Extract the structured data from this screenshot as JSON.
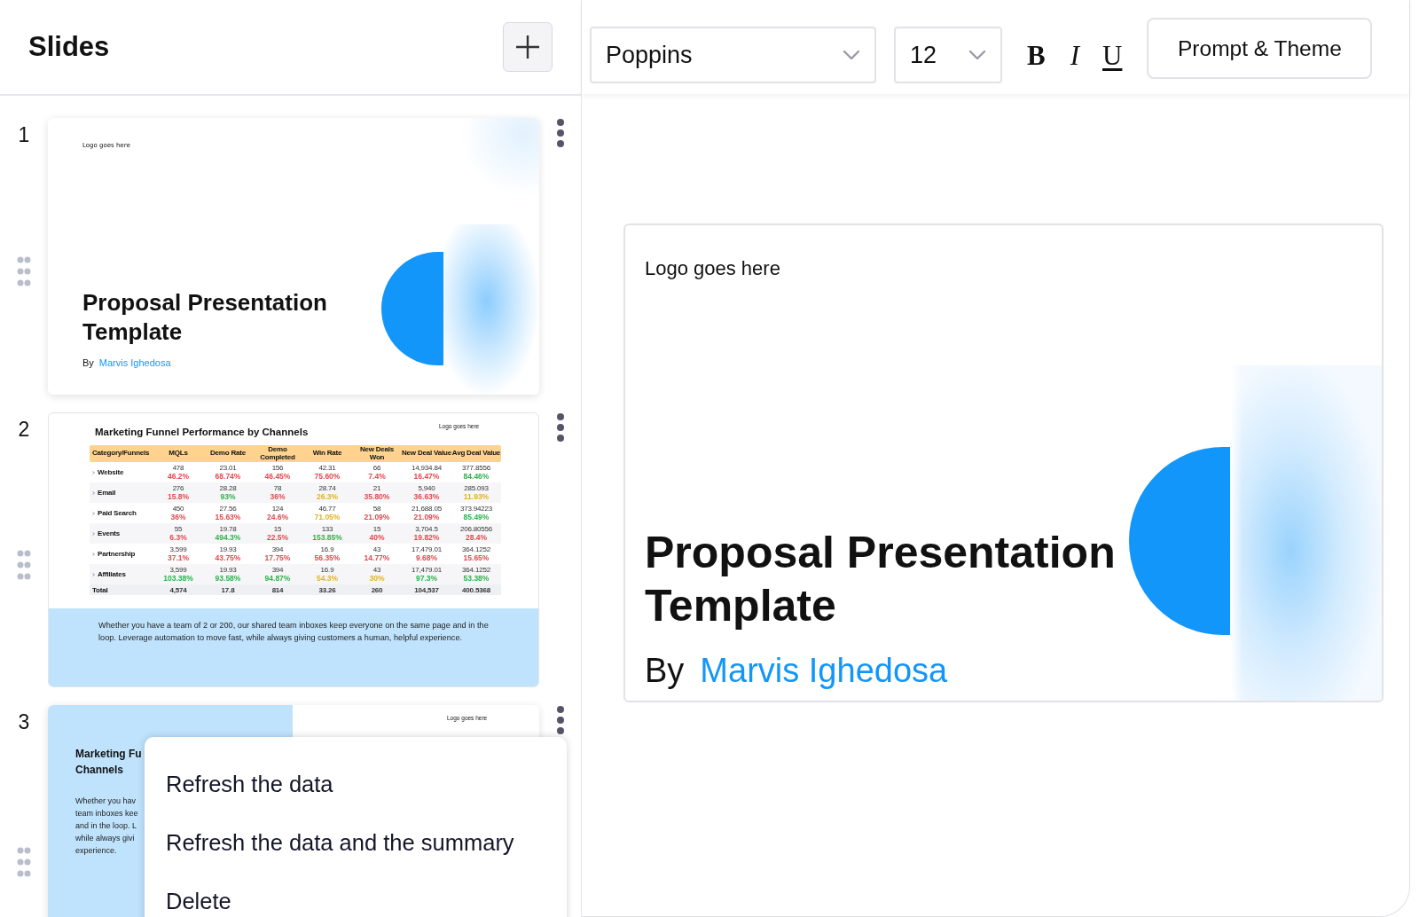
{
  "sidebar": {
    "title": "Slides",
    "slides": [
      {
        "number": "1",
        "kind": "title",
        "logo": "Logo goes here",
        "title": "Proposal Presentation Template",
        "by": "By",
        "author": "Marvis Ighedosa"
      },
      {
        "number": "2",
        "kind": "table",
        "title": "Marketing Funnel Performance by Channels",
        "logo": "Logo goes here",
        "columns": [
          "Category/Funnels",
          "MQLs",
          "Demo Rate",
          "Demo Completed",
          "Win Rate",
          "New Deals Won",
          "New Deal Value",
          "Avg Deal Value"
        ],
        "rows": [
          {
            "name": "Website",
            "values": [
              "478",
              "23.01",
              "156",
              "42.31",
              "66",
              "14,934.84",
              "377.8556"
            ],
            "changes": [
              {
                "text": "46.2%",
                "color": "#e5484d"
              },
              {
                "text": "68.74%",
                "color": "#e5484d"
              },
              {
                "text": "46.45%",
                "color": "#e5484d"
              },
              {
                "text": "75.60%",
                "color": "#e5484d"
              },
              {
                "text": "7.4%",
                "color": "#e5484d"
              },
              {
                "text": "16.47%",
                "color": "#e5484d"
              },
              {
                "text": "84.46%",
                "color": "#2fb14a"
              }
            ]
          },
          {
            "name": "Email",
            "values": [
              "276",
              "28.28",
              "78",
              "28.74",
              "21",
              "5,940",
              "285.093"
            ],
            "changes": [
              {
                "text": "15.8%",
                "color": "#e5484d"
              },
              {
                "text": "93%",
                "color": "#2fb14a"
              },
              {
                "text": "36%",
                "color": "#e5484d"
              },
              {
                "text": "26.3%",
                "color": "#e0b422"
              },
              {
                "text": "35.80%",
                "color": "#e5484d"
              },
              {
                "text": "36.63%",
                "color": "#e5484d"
              },
              {
                "text": "11.93%",
                "color": "#e0b422"
              }
            ]
          },
          {
            "name": "Paid Search",
            "values": [
              "450",
              "27.56",
              "124",
              "46.77",
              "58",
              "21,688.05",
              "373.94223"
            ],
            "changes": [
              {
                "text": "36%",
                "color": "#e5484d"
              },
              {
                "text": "15.63%",
                "color": "#e5484d"
              },
              {
                "text": "24.6%",
                "color": "#e5484d"
              },
              {
                "text": "71.05%",
                "color": "#e0b422"
              },
              {
                "text": "21.09%",
                "color": "#e5484d"
              },
              {
                "text": "21.09%",
                "color": "#e5484d"
              },
              {
                "text": "85.49%",
                "color": "#2fb14a"
              }
            ]
          },
          {
            "name": "Events",
            "values": [
              "55",
              "19.78",
              "15",
              "133",
              "15",
              "3,704.5",
              "206.80556"
            ],
            "changes": [
              {
                "text": "6.3%",
                "color": "#e5484d"
              },
              {
                "text": "494.3%",
                "color": "#2fb14a"
              },
              {
                "text": "22.5%",
                "color": "#e5484d"
              },
              {
                "text": "153.85%",
                "color": "#2fb14a"
              },
              {
                "text": "40%",
                "color": "#e5484d"
              },
              {
                "text": "19.82%",
                "color": "#e5484d"
              },
              {
                "text": "28.4%",
                "color": "#e5484d"
              }
            ]
          },
          {
            "name": "Partnership",
            "values": [
              "3,599",
              "19.93",
              "394",
              "16.9",
              "43",
              "17,479.01",
              "364.1252"
            ],
            "changes": [
              {
                "text": "37.1%",
                "color": "#e5484d"
              },
              {
                "text": "43.75%",
                "color": "#e5484d"
              },
              {
                "text": "17.75%",
                "color": "#e5484d"
              },
              {
                "text": "56.35%",
                "color": "#e5484d"
              },
              {
                "text": "14.77%",
                "color": "#e5484d"
              },
              {
                "text": "9.68%",
                "color": "#e5484d"
              },
              {
                "text": "15.65%",
                "color": "#e5484d"
              }
            ]
          },
          {
            "name": "Affiliates",
            "values": [
              "3,599",
              "19.93",
              "394",
              "16.9",
              "43",
              "17,479.01",
              "364.1252"
            ],
            "changes": [
              {
                "text": "103.38%",
                "color": "#2fb14a"
              },
              {
                "text": "93.58%",
                "color": "#2fb14a"
              },
              {
                "text": "94.87%",
                "color": "#2fb14a"
              },
              {
                "text": "54.3%",
                "color": "#e0b422"
              },
              {
                "text": "30%",
                "color": "#e0b422"
              },
              {
                "text": "97.3%",
                "color": "#2fb14a"
              },
              {
                "text": "53.38%",
                "color": "#2fb14a"
              }
            ]
          }
        ],
        "total": {
          "name": "Total",
          "values": [
            "4,574",
            "17.8",
            "814",
            "33.26",
            "260",
            "104,537",
            "400.5368"
          ]
        },
        "summary": "Whether you have a team of 2 or 200, our shared team inboxes keep everyone on the same page and in the loop. Leverage automation to move fast, while always giving customers a human, helpful experience."
      },
      {
        "number": "3",
        "kind": "split",
        "logo": "Logo goes here",
        "title_lines": [
          "Marketing Fu",
          "Channels"
        ],
        "body_lines": [
          "Whether you hav",
          "team inboxes kee",
          "and in the loop. L",
          "while always givi",
          "experience."
        ]
      }
    ]
  },
  "context_menu": {
    "items": [
      "Refresh the data",
      "Refresh the data and the summary",
      "Delete"
    ]
  },
  "toolbar": {
    "font": "Poppins",
    "size": "12",
    "bold": "B",
    "italic": "I",
    "underline": "U",
    "button": "Prompt & Theme"
  },
  "preview": {
    "logo": "Logo goes here",
    "title": "Proposal Presentation Template",
    "by": "By",
    "author": "Marvis Ighedosa"
  }
}
